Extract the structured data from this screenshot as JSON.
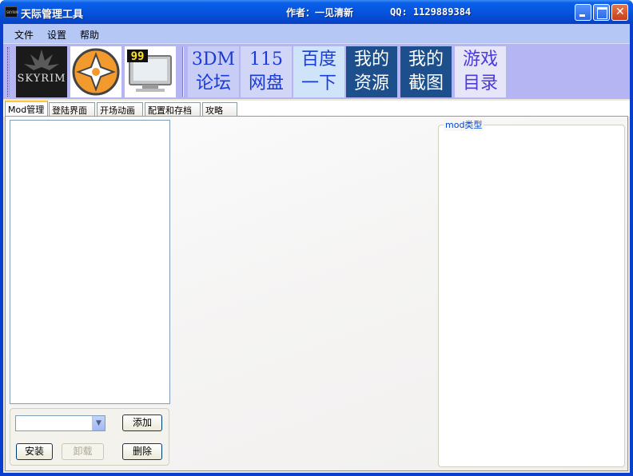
{
  "window": {
    "title": "天际管理工具",
    "author": "作者：一见清新",
    "qq": "QQ: 1129889384",
    "app_icon_text": "SKYRIM"
  },
  "menu": [
    "文件",
    "设置",
    "帮助"
  ],
  "toolbar": {
    "skyrim_logo_text": "SKYRIM",
    "monitor_badge": "99",
    "links": [
      {
        "line1": "3DM",
        "line2": "论坛",
        "color": "#1a3bd6",
        "bg": "#c7cdf5"
      },
      {
        "line1": "115",
        "line2": "网盘",
        "color": "#1a3bd6",
        "bg": "#d1d6f7"
      },
      {
        "line1": "百度",
        "line2": "一下",
        "color": "#1a3bd6",
        "bg": "#cfe3f9"
      },
      {
        "line1": "我的",
        "line2": "资源",
        "color": "#ffffff",
        "bg": "#1c4f8c"
      },
      {
        "line1": "我的",
        "line2": "截图",
        "color": "#ffffff",
        "bg": "#1c4f8c"
      },
      {
        "line1": "游戏",
        "line2": "目录",
        "color": "#4a3adf",
        "bg": "#e6e6f8"
      }
    ]
  },
  "tabs": [
    "Mod管理",
    "登陆界面",
    "开场动画",
    "配置和存档",
    "攻略"
  ],
  "mod_panel": {
    "combo_value": "",
    "add_label": "添加",
    "install_label": "安装",
    "uninstall_label": "卸载",
    "delete_label": "删除"
  },
  "mod_type": {
    "label": "mod类型"
  }
}
